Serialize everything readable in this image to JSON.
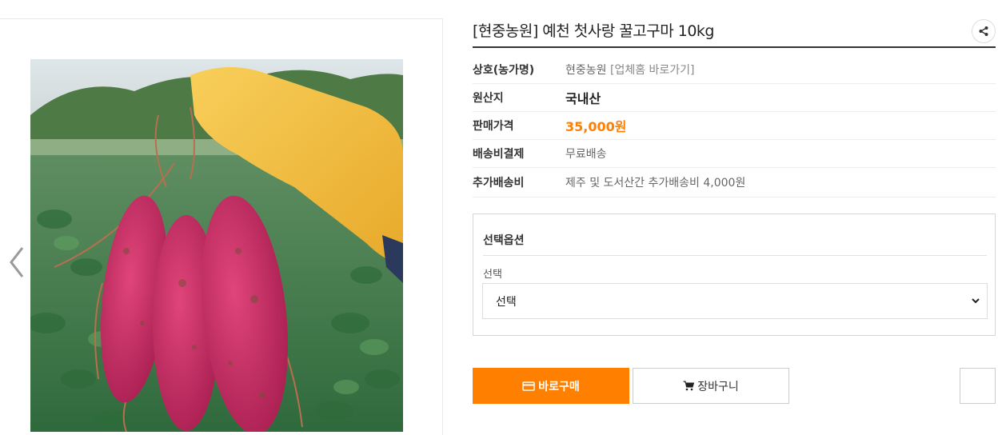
{
  "product": {
    "title": "[현중농원] 예천 첫사랑 꿀고구마 10kg"
  },
  "details": {
    "shop_label": "상호(농가명)",
    "shop_name": "현중농원",
    "shop_link": "[업체홈 바로가기]",
    "origin_label": "원산지",
    "origin_value": "국내산",
    "price_label": "판매가격",
    "price_value": "35,000원",
    "shipping_label": "배송비결제",
    "shipping_value": "무료배송",
    "extra_label": "추가배송비",
    "extra_value": "제주 및 도서산간 추가배송비 4,000원"
  },
  "options": {
    "title": "선택옵션",
    "label": "선택",
    "selected": "선택"
  },
  "actions": {
    "buy_label": "바로구매",
    "cart_label": "장바구니"
  },
  "icons": {
    "prev": "chevron-left-icon",
    "share": "share-icon",
    "card": "credit-card-icon",
    "cart": "cart-icon",
    "dropdown": "chevron-down-icon"
  },
  "colors": {
    "accent": "#ff7f00",
    "price": "#ff7f00",
    "sweet_potato": "#c8285f",
    "glove": "#f2b934",
    "leaves": "#3f7a4a"
  }
}
